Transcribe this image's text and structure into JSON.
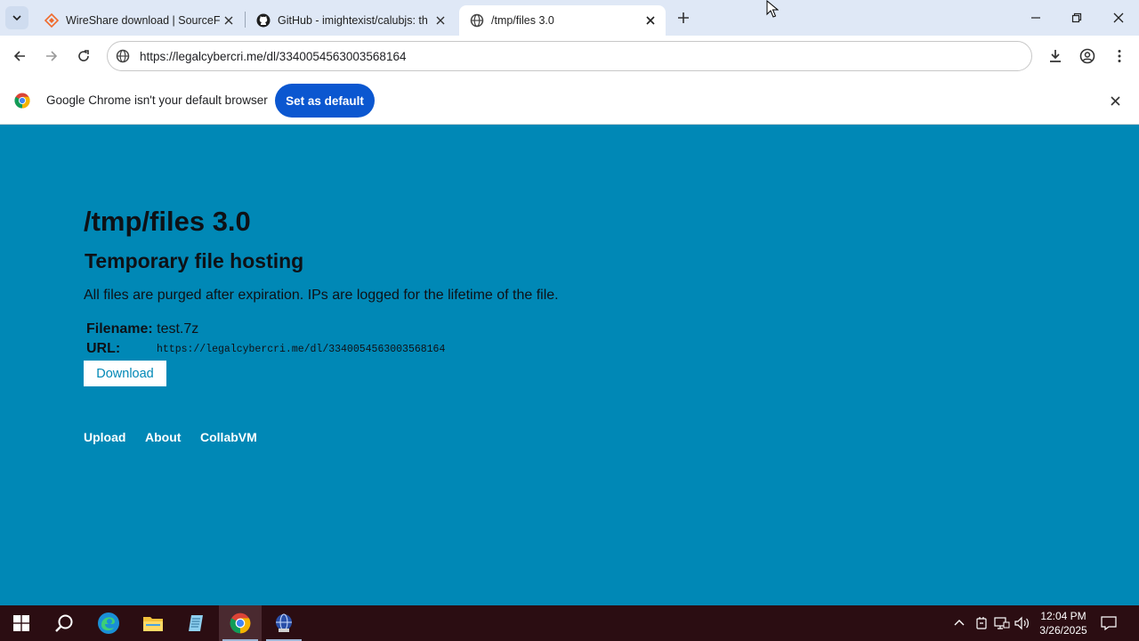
{
  "browser": {
    "tabs": [
      {
        "title": "WireShare download | SourceFo",
        "favicon": "sourceforge-icon"
      },
      {
        "title": "GitHub - imightexist/calubjs: th",
        "favicon": "github-icon"
      },
      {
        "title": "/tmp/files 3.0",
        "favicon": "globe-icon"
      }
    ],
    "address": "https://legalcybercri.me/dl/3340054563003568164",
    "infobar_message": "Google Chrome isn't your default browser",
    "infobar_button": "Set as default"
  },
  "page": {
    "title": "/tmp/files 3.0",
    "subtitle": "Temporary file hosting",
    "description": "All files are purged after expiration. IPs are logged for the lifetime of the file.",
    "filename_label": "Filename:",
    "filename_value": "test.7z",
    "url_label": "URL:",
    "url_value": "https://legalcybercri.me/dl/3340054563003568164",
    "download_label": "Download",
    "links": [
      "Upload",
      "About",
      "CollabVM"
    ]
  },
  "taskbar": {
    "time": "12:04 PM",
    "date": "3/26/2025"
  },
  "colors": {
    "page_bg": "#0088b6",
    "accent_button": "#0b57d0",
    "taskbar_bg": "#2b0d12"
  }
}
